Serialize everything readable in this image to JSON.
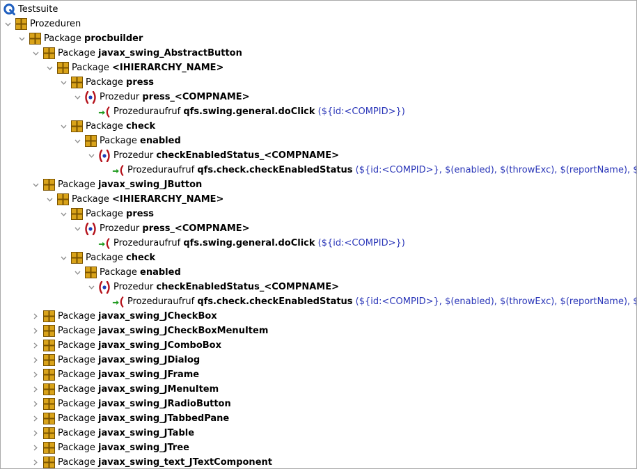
{
  "colors": {
    "package_fill": "#d9a31a",
    "package_dark": "#7a5300",
    "procedure_red": "#b5121b",
    "procedure_blue": "#1d3fb8",
    "call_green": "#1e9a1e",
    "call_red": "#b5121b",
    "params_blue": "#2a36b8",
    "root_blue": "#1f5fbf"
  },
  "rows": [
    {
      "level": 0,
      "toggle": "none",
      "icon": "root-icon",
      "kind": "Testsuite",
      "name": "",
      "params": ""
    },
    {
      "level": 0,
      "toggle": "expanded",
      "icon": "package-icon",
      "kind": "Prozeduren",
      "name": "",
      "params": ""
    },
    {
      "level": 1,
      "toggle": "expanded",
      "icon": "package-icon",
      "kind": "Package ",
      "name": "procbuilder",
      "params": ""
    },
    {
      "level": 2,
      "toggle": "expanded",
      "icon": "package-icon",
      "kind": "Package ",
      "name": "javax_swing_AbstractButton",
      "params": ""
    },
    {
      "level": 3,
      "toggle": "expanded",
      "icon": "package-icon",
      "kind": "Package ",
      "name": "<IHIERARCHY_NAME>",
      "params": ""
    },
    {
      "level": 4,
      "toggle": "expanded",
      "icon": "package-icon",
      "kind": "Package ",
      "name": "press",
      "params": ""
    },
    {
      "level": 5,
      "toggle": "expanded",
      "icon": "procedure-icon",
      "kind": "Prozedur ",
      "name": "press_<COMPNAME>",
      "params": ""
    },
    {
      "level": 6,
      "toggle": "none",
      "icon": "procedure-call-icon",
      "kind": "Prozeduraufruf ",
      "name": "qfs.swing.general.doClick",
      "params": " (${id:<COMPID>})"
    },
    {
      "level": 4,
      "toggle": "expanded",
      "icon": "package-icon",
      "kind": "Package ",
      "name": "check",
      "params": ""
    },
    {
      "level": 5,
      "toggle": "expanded",
      "icon": "package-icon",
      "kind": "Package ",
      "name": "enabled",
      "params": ""
    },
    {
      "level": 6,
      "toggle": "expanded",
      "icon": "procedure-icon",
      "kind": "Prozedur ",
      "name": "checkEnabledStatus_<COMPNAME>",
      "params": ""
    },
    {
      "level": 7,
      "toggle": "none",
      "icon": "procedure-call-icon",
      "kind": "Prozeduraufruf ",
      "name": "qfs.check.checkEnabledStatus",
      "params": " (${id:<COMPID>}, $(enabled), $(throwExc), $(reportName), $(timeout))"
    },
    {
      "level": 2,
      "toggle": "expanded",
      "icon": "package-icon",
      "kind": "Package ",
      "name": "javax_swing_JButton",
      "params": ""
    },
    {
      "level": 3,
      "toggle": "expanded",
      "icon": "package-icon",
      "kind": "Package ",
      "name": "<IHIERARCHY_NAME>",
      "params": ""
    },
    {
      "level": 4,
      "toggle": "expanded",
      "icon": "package-icon",
      "kind": "Package ",
      "name": "press",
      "params": ""
    },
    {
      "level": 5,
      "toggle": "expanded",
      "icon": "procedure-icon",
      "kind": "Prozedur ",
      "name": "press_<COMPNAME>",
      "params": ""
    },
    {
      "level": 6,
      "toggle": "none",
      "icon": "procedure-call-icon",
      "kind": "Prozeduraufruf ",
      "name": "qfs.swing.general.doClick",
      "params": " (${id:<COMPID>})"
    },
    {
      "level": 4,
      "toggle": "expanded",
      "icon": "package-icon",
      "kind": "Package ",
      "name": "check",
      "params": ""
    },
    {
      "level": 5,
      "toggle": "expanded",
      "icon": "package-icon",
      "kind": "Package ",
      "name": "enabled",
      "params": ""
    },
    {
      "level": 6,
      "toggle": "expanded",
      "icon": "procedure-icon",
      "kind": "Prozedur ",
      "name": "checkEnabledStatus_<COMPNAME>",
      "params": ""
    },
    {
      "level": 7,
      "toggle": "none",
      "icon": "procedure-call-icon",
      "kind": "Prozeduraufruf ",
      "name": "qfs.check.checkEnabledStatus",
      "params": " (${id:<COMPID>}, $(enabled), $(throwExc), $(reportName), $(timeout))"
    },
    {
      "level": 2,
      "toggle": "collapsed",
      "icon": "package-icon",
      "kind": "Package ",
      "name": "javax_swing_JCheckBox",
      "params": ""
    },
    {
      "level": 2,
      "toggle": "collapsed",
      "icon": "package-icon",
      "kind": "Package ",
      "name": "javax_swing_JCheckBoxMenuItem",
      "params": ""
    },
    {
      "level": 2,
      "toggle": "collapsed",
      "icon": "package-icon",
      "kind": "Package ",
      "name": "javax_swing_JComboBox",
      "params": ""
    },
    {
      "level": 2,
      "toggle": "collapsed",
      "icon": "package-icon",
      "kind": "Package ",
      "name": "javax_swing_JDialog",
      "params": ""
    },
    {
      "level": 2,
      "toggle": "collapsed",
      "icon": "package-icon",
      "kind": "Package ",
      "name": "javax_swing_JFrame",
      "params": ""
    },
    {
      "level": 2,
      "toggle": "collapsed",
      "icon": "package-icon",
      "kind": "Package ",
      "name": "javax_swing_JMenuItem",
      "params": ""
    },
    {
      "level": 2,
      "toggle": "collapsed",
      "icon": "package-icon",
      "kind": "Package ",
      "name": "javax_swing_JRadioButton",
      "params": ""
    },
    {
      "level": 2,
      "toggle": "collapsed",
      "icon": "package-icon",
      "kind": "Package ",
      "name": "javax_swing_JTabbedPane",
      "params": ""
    },
    {
      "level": 2,
      "toggle": "collapsed",
      "icon": "package-icon",
      "kind": "Package ",
      "name": "javax_swing_JTable",
      "params": ""
    },
    {
      "level": 2,
      "toggle": "collapsed",
      "icon": "package-icon",
      "kind": "Package ",
      "name": "javax_swing_JTree",
      "params": ""
    },
    {
      "level": 2,
      "toggle": "collapsed",
      "icon": "package-icon",
      "kind": "Package ",
      "name": "javax_swing_text_JTextComponent",
      "params": ""
    }
  ]
}
